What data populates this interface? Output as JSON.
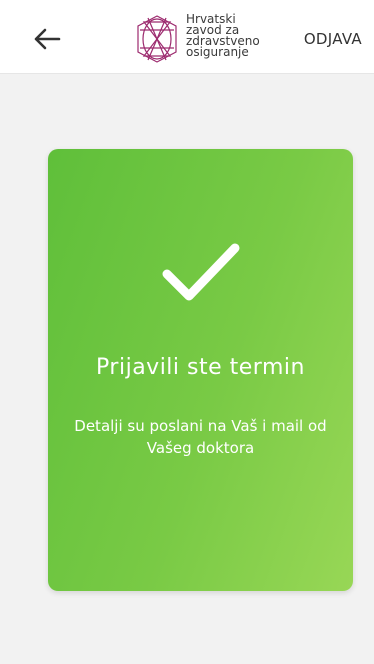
{
  "header": {
    "back_icon": "arrow-left-icon",
    "logo_lines": [
      "Hrvatski",
      "zavod za",
      "zdravstveno",
      "osiguranje"
    ],
    "logout_label": "ODJAVA"
  },
  "card": {
    "icon": "checkmark-icon",
    "title": "Prijavili ste termin",
    "message": "Detalji su poslani na Vaš i mail od Vašeg doktora",
    "gradient_start": "#5fbf3a",
    "gradient_end": "#98d756"
  },
  "colors": {
    "background": "#f2f2f2",
    "header_bg": "#ffffff",
    "logo_accent": "#9c2a6e"
  }
}
